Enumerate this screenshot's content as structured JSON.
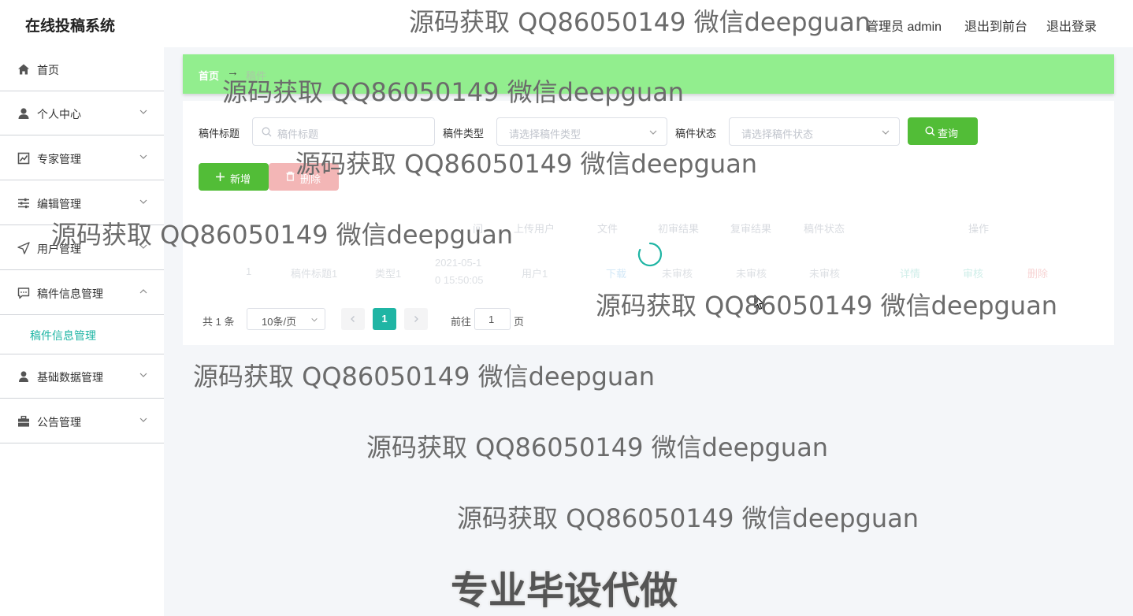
{
  "header": {
    "app_title": "在线投稿系统",
    "admin_label": "管理员 admin",
    "to_front": "退出到前台",
    "logout": "退出登录"
  },
  "sidebar": {
    "items": [
      {
        "label": "首页",
        "icon": "home-icon"
      },
      {
        "label": "个人中心",
        "icon": "user-icon"
      },
      {
        "label": "专家管理",
        "icon": "chart-icon"
      },
      {
        "label": "编辑管理",
        "icon": "sliders-icon"
      },
      {
        "label": "用户管理",
        "icon": "send-icon"
      },
      {
        "label": "稿件信息管理",
        "icon": "chat-icon"
      },
      {
        "label": "基础数据管理",
        "icon": "person-icon"
      },
      {
        "label": "公告管理",
        "icon": "briefcase-icon"
      }
    ],
    "sub_item": "稿件信息管理"
  },
  "breadcrumb": {
    "home": "首页",
    "separator": "→",
    "current": "稿件"
  },
  "filters": {
    "title_label": "稿件标题",
    "title_placeholder": "稿件标题",
    "type_label": "稿件类型",
    "type_placeholder": "请选择稿件类型",
    "status_label": "稿件状态",
    "status_placeholder": "请选择稿件状态",
    "search_button": "查询"
  },
  "actions": {
    "add": "新增",
    "delete": "删除"
  },
  "table": {
    "headers": [
      "间",
      "上传用户",
      "文件",
      "初审结果",
      "复审结果",
      "稿件状态",
      "操作"
    ],
    "row": {
      "index": "1",
      "title": "稿件标题1",
      "type": "类型1",
      "time_line1": "2021-05-1",
      "time_line2": "0 15:50:05",
      "user": "用户1",
      "file": "下载",
      "first_review": "未审核",
      "second_review": "未审核",
      "status": "未审核",
      "op_detail": "详情",
      "op_review": "审核",
      "op_delete": "删除"
    }
  },
  "pagination": {
    "total": "共 1 条",
    "page_size": "10条/页",
    "current_page": "1",
    "goto_label": "前往",
    "goto_value": "1",
    "page_unit": "页"
  },
  "watermarks": {
    "text": "源码获取 QQ86050149 微信deepguan",
    "big": "专业毕设代做"
  },
  "colors": {
    "accent": "#1fb5a4",
    "primary_button": "#52bd37",
    "danger_button": "#f3b6b6",
    "breadcrumb_bg": "#92ee8e"
  }
}
